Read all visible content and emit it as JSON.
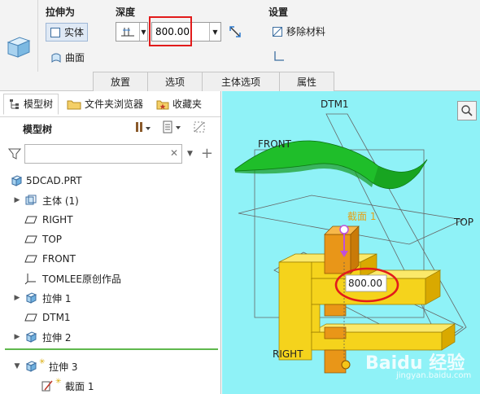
{
  "ribbon": {
    "extrude_as": {
      "title": "拉伸为",
      "solid_label": "实体",
      "surface_label": "曲面"
    },
    "depth": {
      "title": "深度",
      "value": "800.00"
    },
    "settings": {
      "title": "设置",
      "remove_material_label": "移除材料"
    },
    "tabs": [
      "放置",
      "选项",
      "主体选项",
      "属性"
    ]
  },
  "panel": {
    "tabs": [
      "模型树",
      "文件夹浏览器",
      "收藏夹"
    ],
    "tree_title": "模型树",
    "filter_placeholder": "",
    "tree": [
      {
        "label": "5DCAD.PRT",
        "icon": "part-icon",
        "expand": ""
      },
      {
        "label": "主体 (1)",
        "icon": "body-icon",
        "expand": "▶"
      },
      {
        "label": "RIGHT",
        "icon": "datum-plane-icon",
        "expand": ""
      },
      {
        "label": "TOP",
        "icon": "datum-plane-icon",
        "expand": ""
      },
      {
        "label": "FRONT",
        "icon": "datum-plane-icon",
        "expand": ""
      },
      {
        "label": "TOMLEE原创作品",
        "icon": "csys-icon",
        "expand": ""
      },
      {
        "label": "拉伸 1",
        "icon": "extrude-icon",
        "expand": "▶"
      },
      {
        "label": "DTM1",
        "icon": "datum-plane-icon",
        "expand": ""
      },
      {
        "label": "拉伸 2",
        "icon": "extrude-icon",
        "expand": "▶"
      },
      {
        "label": "拉伸 3",
        "icon": "extrude-icon",
        "expand": "▼"
      },
      {
        "label": "截面 1",
        "icon": "sketch-icon",
        "expand": ""
      }
    ]
  },
  "viewport": {
    "labels": {
      "dtm1": "DTM1",
      "front": "FRONT",
      "top": "TOP",
      "right": "RIGHT",
      "section": "截面 1"
    },
    "dimension": "800.00",
    "watermark": "Baidu 经验",
    "watermark_url": "jingyan.baidu.com"
  },
  "colors": {
    "viewport_bg": "#8ff2f7",
    "surface_green": "#1fbe2a",
    "solid_yellow": "#f5d31c",
    "solid_orange": "#e99618",
    "highlight_red": "#e21b1b"
  }
}
